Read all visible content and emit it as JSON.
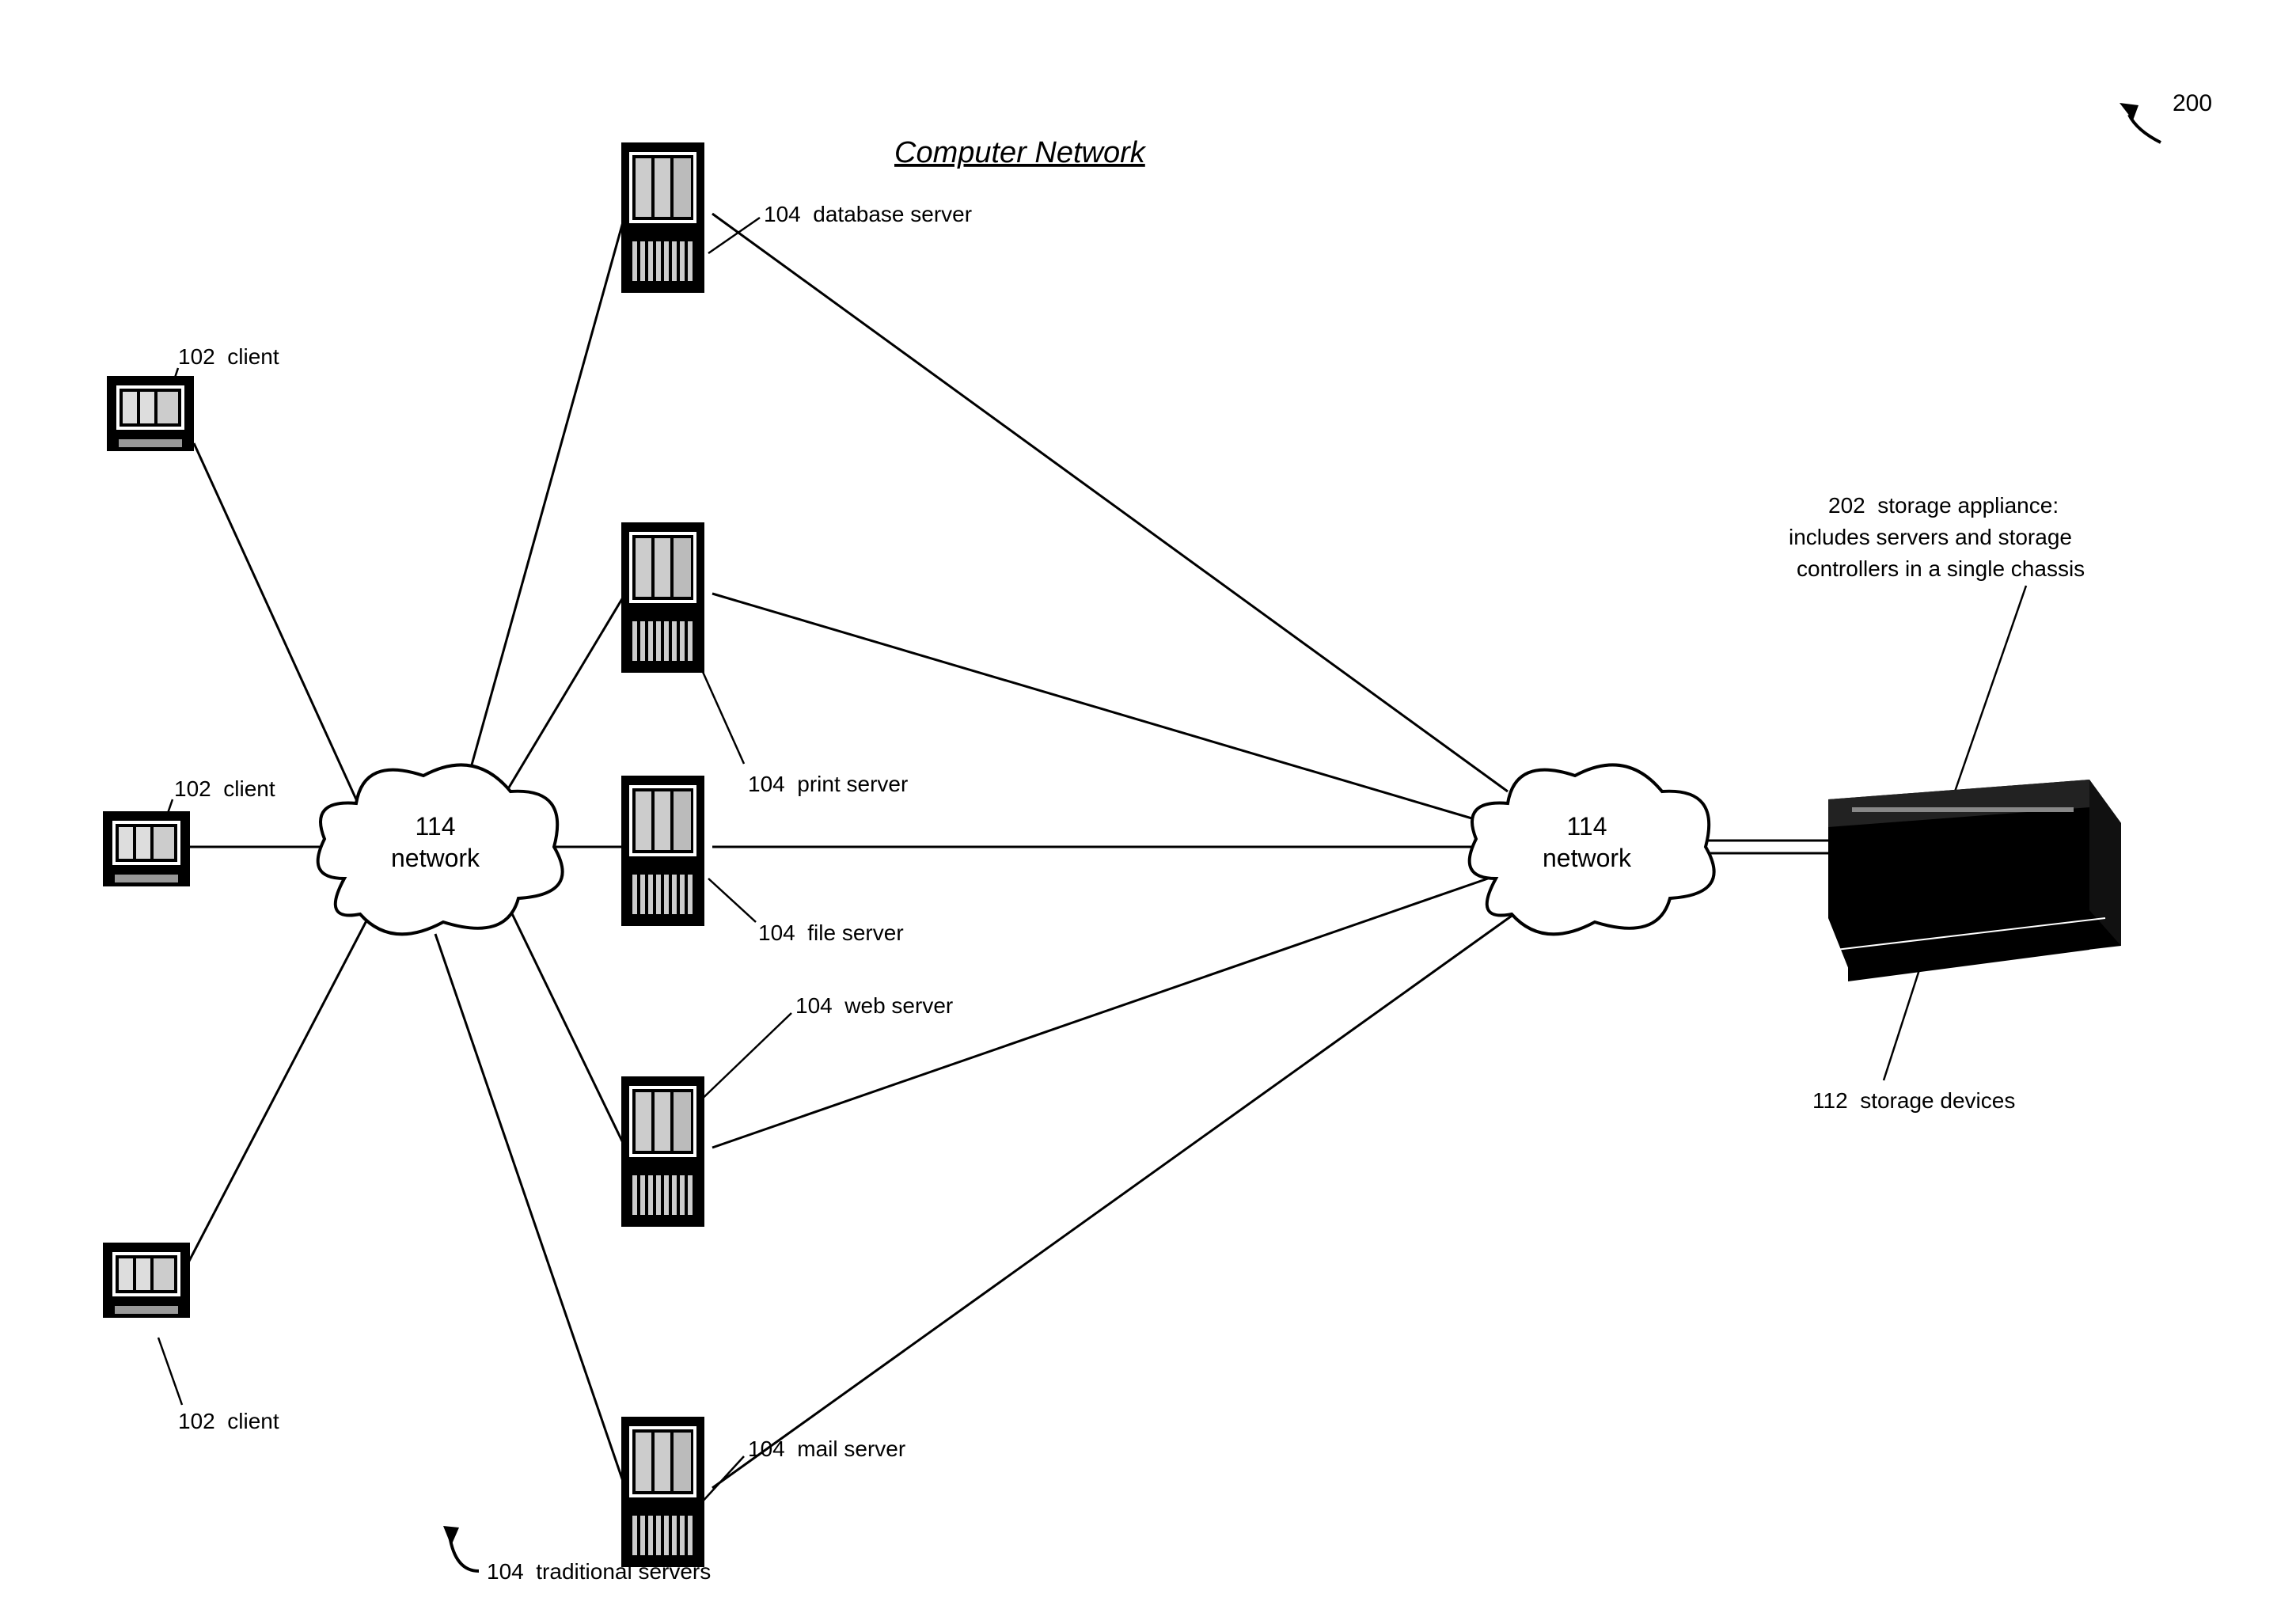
{
  "title": "Computer Network",
  "figure_ref": "200",
  "clients": [
    {
      "ref": "102",
      "label": "client"
    },
    {
      "ref": "102",
      "label": "client"
    },
    {
      "ref": "102",
      "label": "client"
    }
  ],
  "networks": [
    {
      "ref": "114",
      "label": "network"
    },
    {
      "ref": "114",
      "label": "network"
    }
  ],
  "servers": [
    {
      "ref": "104",
      "label": "database server"
    },
    {
      "ref": "104",
      "label": "print server"
    },
    {
      "ref": "104",
      "label": "file server"
    },
    {
      "ref": "104",
      "label": "web server"
    },
    {
      "ref": "104",
      "label": "mail server"
    }
  ],
  "server_group": {
    "ref": "104",
    "label": "traditional servers"
  },
  "appliance": {
    "ref": "202",
    "label_line1": "storage appliance:",
    "label_line2": "includes servers and storage",
    "label_line3": "controllers in a single chassis"
  },
  "storage_devices": {
    "ref": "112",
    "label": "storage devices"
  }
}
